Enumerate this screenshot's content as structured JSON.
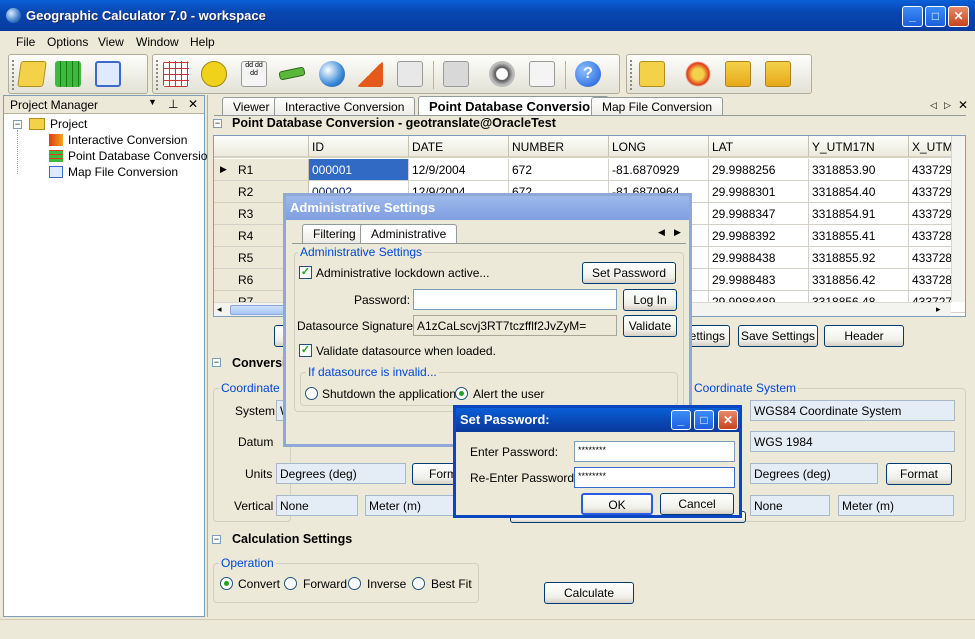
{
  "app": {
    "title": "Geographic Calculator 7.0 - workspace"
  },
  "menu": [
    "File",
    "Options",
    "View",
    "Window",
    "Help"
  ],
  "project_manager": {
    "title": "Project Manager",
    "root": "Project",
    "items": [
      "Interactive Conversion",
      "Point Database Conversion",
      "Map File Conversion"
    ]
  },
  "tabs": [
    "Viewer",
    "Interactive Conversion",
    "Point Database Conversion",
    "Map File Conversion"
  ],
  "panel_title": "Point Database Conversion - geotranslate@OracleTest",
  "grid": {
    "columns": [
      "ID",
      "DATE",
      "NUMBER",
      "LONG",
      "LAT",
      "Y_UTM17N",
      "X_UTM"
    ],
    "rows": [
      {
        "label": "R1",
        "cells": [
          "000001",
          "12/9/2004",
          "672",
          "-81.6870929",
          "29.9988256",
          "3318853.90",
          "433729"
        ]
      },
      {
        "label": "R2",
        "cells": [
          "000002",
          "12/9/2004",
          "672",
          "-81.6870964",
          "29.9988301",
          "3318854.40",
          "433729"
        ]
      },
      {
        "label": "R3",
        "cells": [
          "",
          "",
          "",
          "",
          "29.9988347",
          "3318854.91",
          "433729"
        ]
      },
      {
        "label": "R4",
        "cells": [
          "",
          "",
          "",
          "",
          "29.9988392",
          "3318855.41",
          "433728"
        ]
      },
      {
        "label": "R5",
        "cells": [
          "",
          "",
          "",
          "",
          "29.9988438",
          "3318855.92",
          "433728"
        ]
      },
      {
        "label": "R6",
        "cells": [
          "",
          "",
          "",
          "",
          "29.9988483",
          "3318856.42",
          "433728"
        ]
      },
      {
        "label": "R7",
        "cells": [
          "",
          "",
          "",
          "",
          "29.9988489",
          "3318856.48",
          "433727"
        ]
      }
    ]
  },
  "settings_buttons": {
    "settings": "ettings",
    "save": "Save Settings",
    "header": "Header"
  },
  "conversion": {
    "title": "Conversi",
    "left_group": "Coordinate S",
    "right_group": "Coordinate System",
    "labels": {
      "system": "System",
      "datum": "Datum",
      "units": "Units",
      "vertical": "Vertical"
    },
    "left": {
      "system": "W",
      "units": "Degrees (deg)",
      "format": "Form",
      "vertical": "None",
      "vunit": "Meter (m)"
    },
    "right": {
      "system": "WGS84 Coordinate System",
      "datum": "WGS 1984",
      "units": "Degrees (deg)",
      "format": "Format",
      "vertical": "None",
      "vunit": "Meter (m)"
    }
  },
  "calculation": {
    "title": "Calculation Settings",
    "operation": "Operation",
    "options": [
      "Convert",
      "Forward",
      "Inverse",
      "Best Fit"
    ],
    "calculate": "Calculate"
  },
  "admin": {
    "title": "Administrative Settings",
    "tabs": [
      "Filtering",
      "Administrative"
    ],
    "group": "Administrative Settings",
    "lockdown": "Administrative lockdown active...",
    "set_password": "Set Password",
    "password_label": "Password:",
    "login": "Log In",
    "signature_label": "Datasource Signature:",
    "signature": "A1zCaLscvj3RT7tczfflf2JvZyM=",
    "validate": "Validate",
    "validate_on_load": "Validate datasource when loaded.",
    "invalid_group": "If datasource is invalid...",
    "invalid_options": [
      "Shutdown the application",
      "Alert the user"
    ]
  },
  "setpw": {
    "title": "Set Password:",
    "enter_label": "Enter Password:",
    "reenter_label": "Re-Enter Password:",
    "enter_value": "********",
    "reenter_value": "********",
    "ok": "OK",
    "cancel": "Cancel"
  }
}
